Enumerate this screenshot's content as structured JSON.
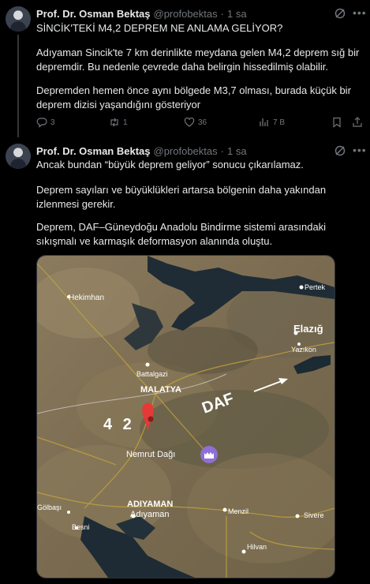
{
  "tweet1": {
    "author": "Prof. Dr. Osman Bektaş",
    "handle": "@profobektas",
    "dot": "·",
    "time": "1 sa",
    "headline": "SİNCİK'TEKİ M4,2 DEPREM NE ANLAMA GELİYOR?",
    "para1": "Adıyaman Sincik'te 7 km derinlikte meydana gelen M4,2 deprem sığ bir depremdir. Bu nedenle çevrede daha belirgin hissedilmiş olabilir.",
    "para2": "Depremden hemen önce aynı bölgede M3,7 olması, burada küçük bir deprem dizisi yaşandığını gösteriyor",
    "replies": "3",
    "reposts": "1",
    "likes": "36",
    "views": "7 B"
  },
  "tweet2": {
    "author": "Prof. Dr. Osman Bektaş",
    "handle": "@profobektas",
    "dot": "·",
    "time": "1 sa",
    "para1": "Ancak bundan “büyük deprem geliyor” sonucu çıkarılamaz.",
    "para2": "Deprem sayıları ve büyüklükleri artarsa bölgenin daha yakından izlenmesi gerekir.",
    "para3": "Deprem, DAF–Güneydoğu Anadolu Bindirme sistemi arasındaki sıkışmalı ve karmaşık deformasyon alanında oluştu."
  },
  "map": {
    "labels": {
      "hekimhan": "Hekimhan",
      "elazig": "Elazığ",
      "yazikonak": "Yazıkon",
      "pertek": "Pertek",
      "battalgazi": "Battalgazi",
      "malatya": "MALATYA",
      "daf": "DAF",
      "magnitude": "4 2",
      "nemrut": "Nemrut Dağı",
      "adiyaman_caps": "ADIYAMAN",
      "adiyaman": "Adıyaman",
      "menzil": "Menzil",
      "siverek": "Sivere",
      "hilvan": "Hilvan",
      "golbasi": "Gölbaşı",
      "besni": "Besni"
    }
  },
  "colors": {
    "accent": "#1d9bf0",
    "muted": "#71767b",
    "pin": "#e53935",
    "daf": "#ffffff"
  }
}
